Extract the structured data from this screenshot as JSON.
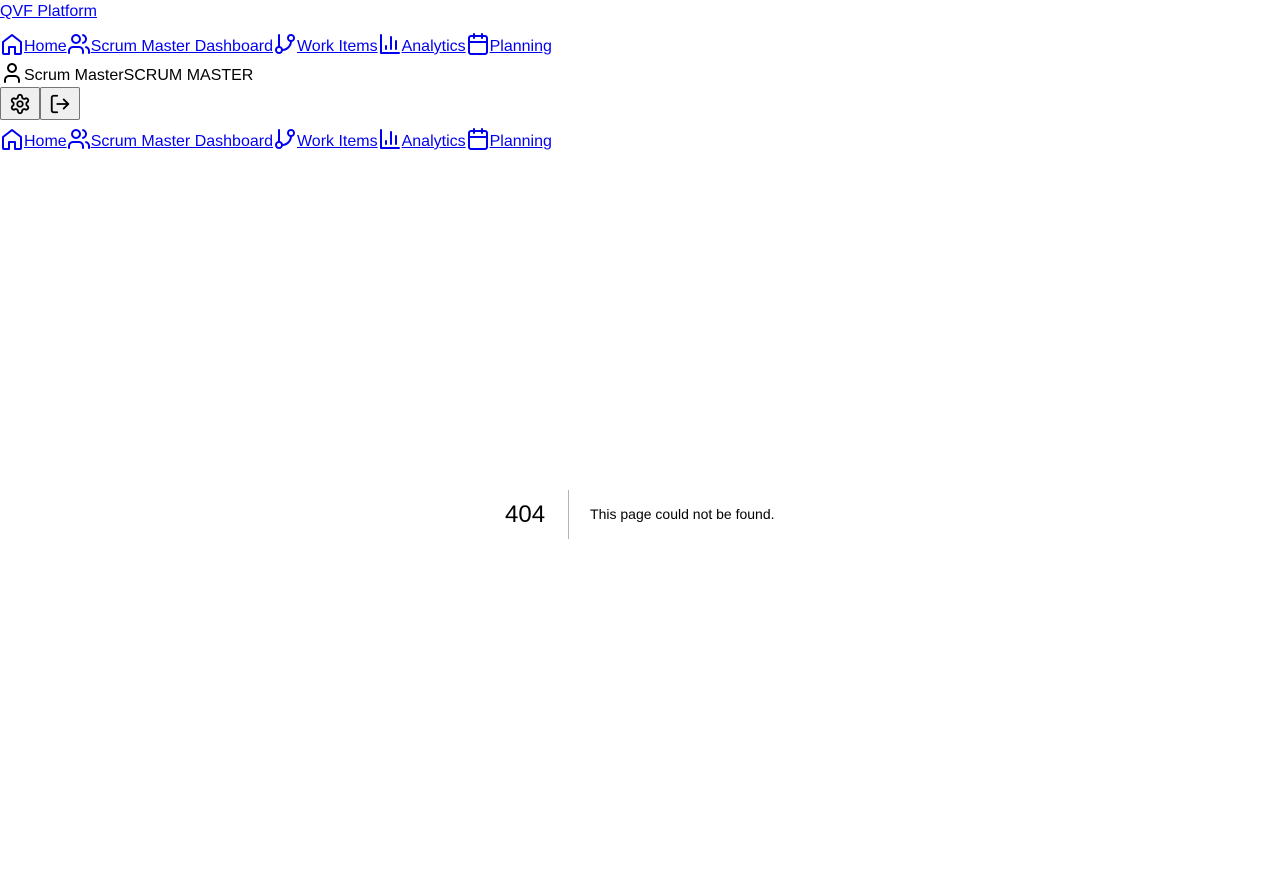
{
  "brand": {
    "label": "QVF Platform"
  },
  "nav": {
    "items": [
      {
        "label": "Home",
        "icon": "home-icon"
      },
      {
        "label": "Scrum Master Dashboard",
        "icon": "users-icon"
      },
      {
        "label": "Work Items",
        "icon": "git-branch-icon"
      },
      {
        "label": "Analytics",
        "icon": "bar-chart-icon"
      },
      {
        "label": "Planning",
        "icon": "calendar-icon"
      }
    ]
  },
  "user": {
    "name": "Scrum Master",
    "role": "SCRUM MASTER",
    "icon": "user-icon"
  },
  "actions": {
    "settings_icon": "settings-icon",
    "logout_icon": "logout-icon"
  },
  "error": {
    "code": "404",
    "message": "This page could not be found."
  },
  "colors": {
    "link": "#0000ee",
    "text": "#000000",
    "background": "#ffffff"
  }
}
